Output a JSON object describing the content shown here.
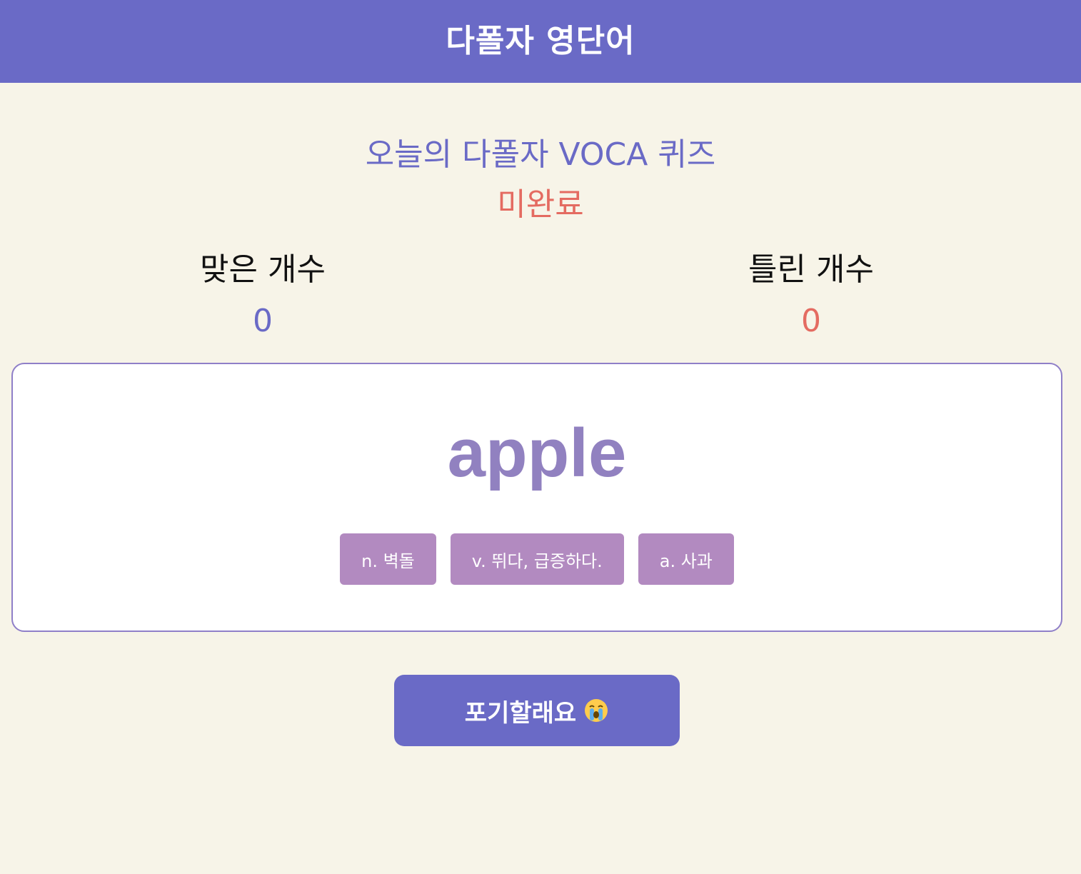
{
  "header": {
    "title": "다폴자 영단어"
  },
  "quiz": {
    "title": "오늘의 다폴자 VOCA 퀴즈",
    "status": "미완료"
  },
  "scores": {
    "correct_label": "맞은 개수",
    "correct_value": "0",
    "wrong_label": "틀린 개수",
    "wrong_value": "0"
  },
  "card": {
    "word": "apple",
    "options": [
      {
        "label": "n. 벽돌"
      },
      {
        "label": "v. 뛰다, 급증하다."
      },
      {
        "label": "a. 사과"
      }
    ]
  },
  "give_up": {
    "label": "포기할래요",
    "icon": "crying-face-icon"
  },
  "colors": {
    "primary": "#6a6ac6",
    "accent_red": "#e46b61",
    "option_bg": "#b28ac0",
    "word": "#9181c0",
    "background": "#f7f4e8"
  }
}
